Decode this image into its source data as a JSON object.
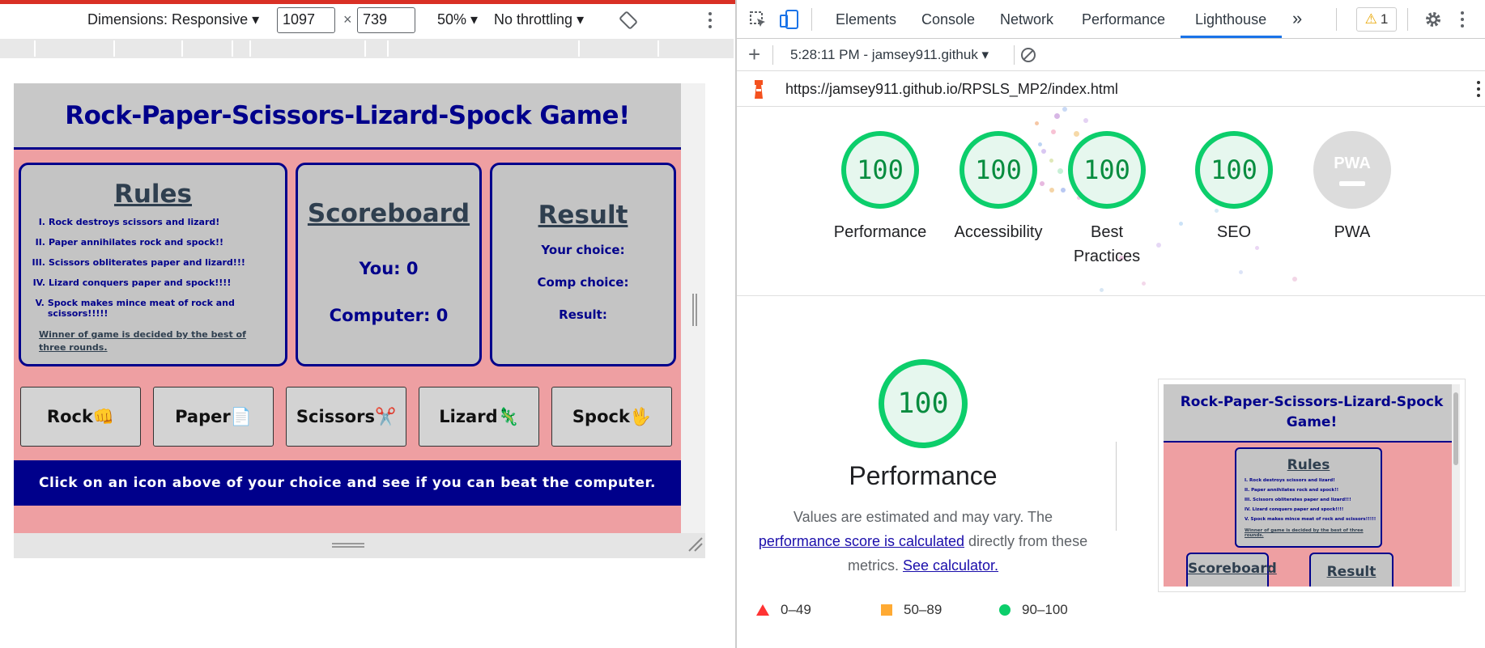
{
  "device_toolbar": {
    "dimensions_label": "Dimensions: Responsive",
    "width_value": "1097",
    "times": "×",
    "height_value": "739",
    "zoom": "50%",
    "throttling": "No throttling"
  },
  "game": {
    "title": "Rock-Paper-Scissors-Lizard-Spock Game!",
    "rules_heading": "Rules",
    "rules": [
      {
        "num": "I.",
        "text": "Rock destroys scissors and lizard!"
      },
      {
        "num": "II.",
        "text": "Paper annihilates rock and spock!!"
      },
      {
        "num": "III.",
        "text": "Scissors obliterates paper and lizard!!!"
      },
      {
        "num": "IV.",
        "text": "Lizard conquers paper and spock!!!!"
      },
      {
        "num": "V.",
        "text": "Spock makes mince meat of rock and scissors!!!!!"
      }
    ],
    "rules_note": "Winner of game is decided by the best of three rounds.",
    "scoreboard_heading": "Scoreboard",
    "you_score": "You: 0",
    "computer_score": "Computer: 0",
    "result_heading": "Result",
    "your_choice": "Your choice:",
    "comp_choice": "Comp choice:",
    "result_label": "Result:",
    "buttons": [
      {
        "label": "Rock",
        "emoji": "👊"
      },
      {
        "label": "Paper",
        "emoji": "📄"
      },
      {
        "label": "Scissors",
        "emoji": "✂️"
      },
      {
        "label": "Lizard",
        "emoji": "🦎"
      },
      {
        "label": "Spock",
        "emoji": "🖖"
      }
    ],
    "footer": "Click on an icon above of your choice and see if you can beat the computer."
  },
  "devtools": {
    "tabs": [
      "Elements",
      "Console",
      "Network",
      "Performance",
      "Lighthouse"
    ],
    "active_tab": "Lighthouse",
    "more_tabs": "»",
    "warning_count": "1",
    "report_label": "5:28:11 PM - jamsey911.githuk",
    "url": "https://jamsey911.github.io/RPSLS_MP2/index.html"
  },
  "lighthouse": {
    "scores": [
      {
        "value": "100",
        "label": "Performance"
      },
      {
        "value": "100",
        "label": "Accessibility"
      },
      {
        "value": "100",
        "label": "Best Practices"
      },
      {
        "value": "100",
        "label": "SEO"
      }
    ],
    "pwa_label": "PWA",
    "pwa_badge": "PWA",
    "performance_score": "100",
    "performance_title": "Performance",
    "desc_prefix": "Values are estimated and may vary. The",
    "desc_link1": "performance score is calculated",
    "desc_mid": "directly from these metrics.",
    "desc_link2": "See calculator.",
    "legend": [
      {
        "range": "0–49",
        "color": "#ff3333"
      },
      {
        "range": "50–89",
        "color": "#ffaa33"
      },
      {
        "range": "90–100",
        "color": "#0cce6b"
      }
    ],
    "thumb": {
      "title": "Rock-Paper-Scissors-Lizard-Spock Game!",
      "rules_heading": "Rules",
      "rules": [
        "I. Rock destroys scissors and lizard!",
        "II. Paper annihilates rock and spock!!",
        "III. Scissors obliterates paper and lizard!!!",
        "IV. Lizard conquers paper and spock!!!!",
        "V. Spock makes mince meat of rock and scissors!!!!!"
      ],
      "note": "Winner of game is decided by the best of three rounds.",
      "scoreboard": "Scoreboard",
      "result": "Result"
    }
  }
}
